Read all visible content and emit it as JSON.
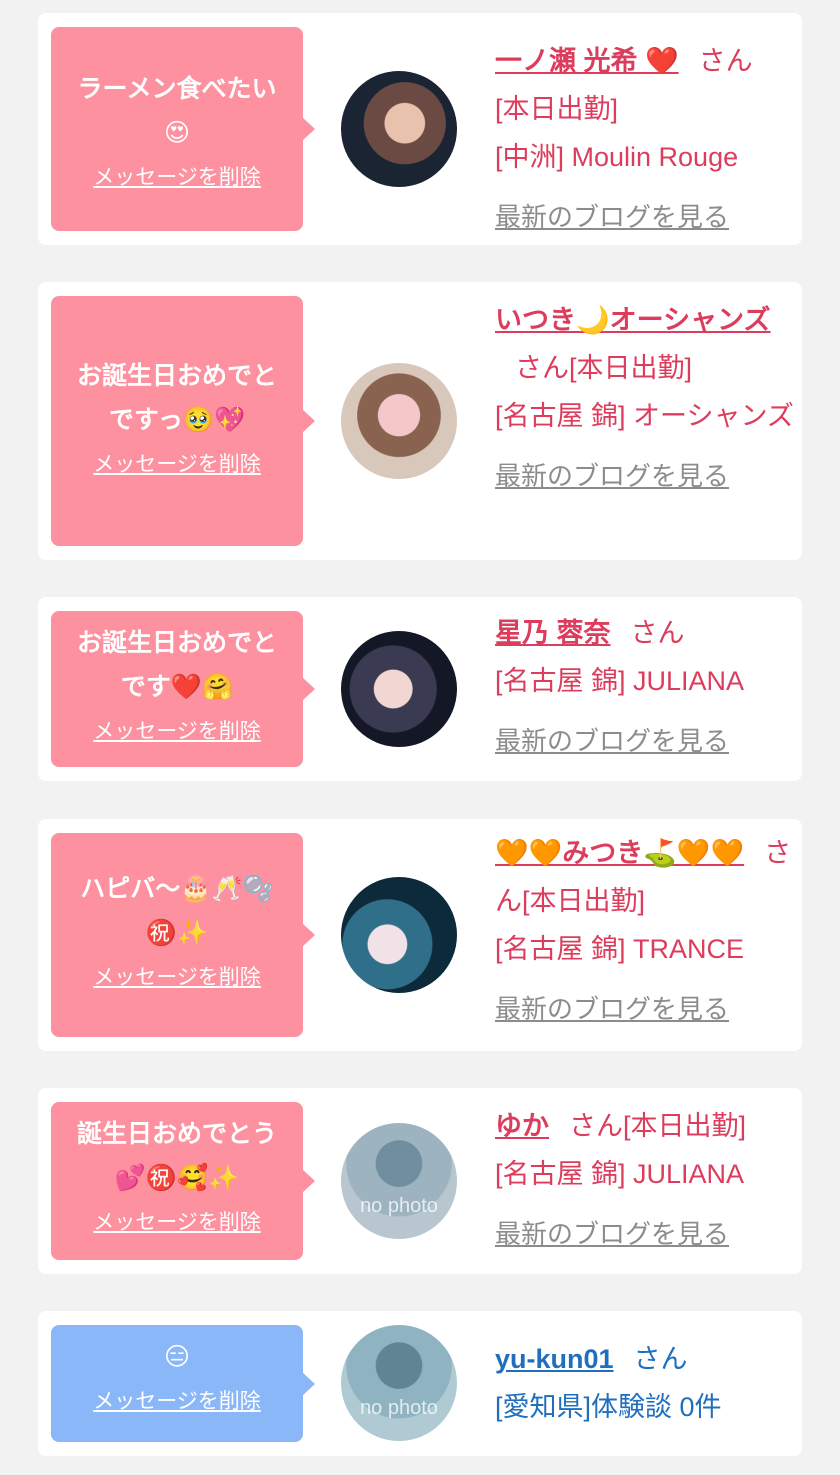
{
  "delete_label": "メッセージを削除",
  "blog_label": "最新のブログを見る",
  "san": "さん",
  "items": [
    {
      "message": "ラーメン食べたい\n😍",
      "name": "一ノ瀬 光希 ❤️",
      "status": "[本日出勤]",
      "shop": "[中洲] Moulin Rouge",
      "avatar": "photo"
    },
    {
      "message": "お誕生日おめでと\nですっ🥹💖",
      "name": "いつき🌙オーシャンズ",
      "status": "[本日出勤]",
      "shop": "[名古屋 錦] オーシャンズ",
      "avatar": "photo"
    },
    {
      "message": "お誕生日おめでと\nです❤️🤗",
      "name": "星乃 蓉奈",
      "status": "",
      "shop": "[名古屋 錦] JULIANA",
      "avatar": "photo"
    },
    {
      "message": "ハピバ〜🎂🥂🫧\n㊗️✨",
      "name": "🧡🧡みつき⛳🧡🧡",
      "status": "[本日出勤]",
      "shop": "[名古屋 錦] TRANCE",
      "avatar": "photo"
    },
    {
      "message": "誕生日おめでとう\n💕㊗️🥰✨",
      "name": "ゆか",
      "status": "[本日出勤]",
      "shop": "[名古屋 錦] JULIANA",
      "avatar": "no photo"
    },
    {
      "message": "😑",
      "name": "yu-kun01",
      "status": "",
      "shop": "[愛知県]体験談 0件",
      "avatar": "no photo"
    }
  ]
}
